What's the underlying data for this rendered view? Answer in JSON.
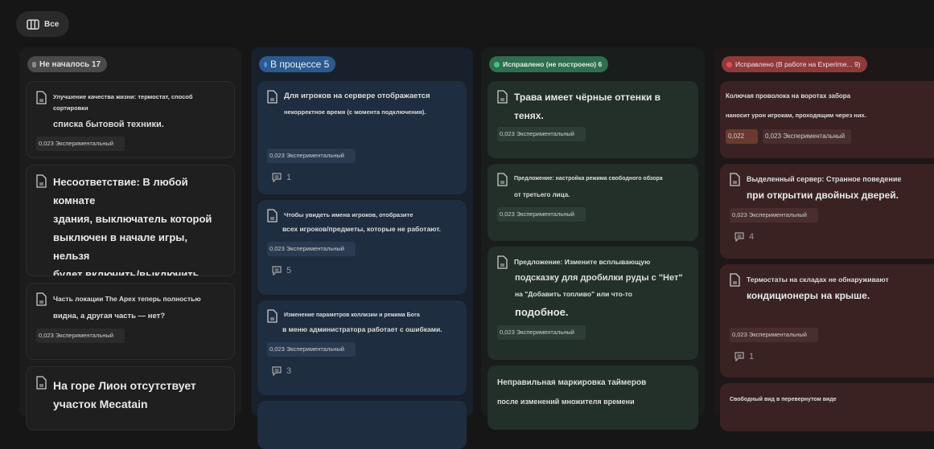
{
  "toolbar": {
    "view_label": "Все"
  },
  "tag_label": "0,023 Экспериментальный",
  "columns": [
    {
      "title": "Не началось 17",
      "color": "#8a8a8a",
      "cards": [
        {
          "line1": "Улучшение качества жизни: термостат, способ сортировки",
          "line2": "списка бытовой техники."
        },
        {
          "line1": "Несоответствие: В любой комнате",
          "line2": "здания, выключатель которой",
          "line3": "выключен в начале игры, нельзя",
          "line4": "будет включить/выключить свет."
        },
        {
          "line1": "Часть локации The Apex теперь полностью",
          "line2": "видна, а другая часть — нет?"
        },
        {
          "line1": "На горе Лион отсутствует",
          "line2": "участок Mecatain"
        }
      ]
    },
    {
      "title": "В процессе 5",
      "color": "#3a78c2",
      "cards": [
        {
          "line1": "Для игроков на сервере отображается",
          "line2": "некорректное время (с момента подключения).",
          "comments": "1"
        },
        {
          "line1": "Чтобы увидеть имена игроков, отобразите",
          "line2": "всех игроков/предметы, которые не работают.",
          "comments": "5"
        },
        {
          "line1": "Изменение параметров коллизии и режима Бога",
          "line2": "в меню администратора работает с ошибками.",
          "comments": "3"
        }
      ]
    },
    {
      "title": "Исправлено (не построено) 6",
      "color": "#3a9a68",
      "cards": [
        {
          "line1": "Трава имеет чёрные оттенки в",
          "line2": "тенях."
        },
        {
          "line1": "Предложение: настройка режима свободного обзора",
          "line2": "от третьего лица."
        },
        {
          "line1": "Предложение: Измените всплывающую",
          "line2": "подсказку для дробилки руды с \"Нет\"",
          "line3": "на \"Добавить топливо\" или что-то",
          "line4": "подобное."
        },
        {
          "line1": "Неправильная маркировка таймеров",
          "line2": "после изменений множителя времени"
        }
      ]
    },
    {
      "title": "Исправлено (В работе на Experime... 9)",
      "color": "#d04848",
      "cards": [
        {
          "line1": "Колючая проволока на воротах забора",
          "line2": "наносит урон игрокам, проходящим через них.",
          "extra_tag": "0,022"
        },
        {
          "line1": "Выделенный сервер: Странное поведение",
          "line2": "при открытии двойных дверей.",
          "comments": "4"
        },
        {
          "line1": "Термостаты на складах не обнаруживают",
          "line2": "кондиционеры на крыше.",
          "comments": "1"
        },
        {
          "line1": "Свободный вид в перевернутом виде"
        }
      ]
    }
  ]
}
